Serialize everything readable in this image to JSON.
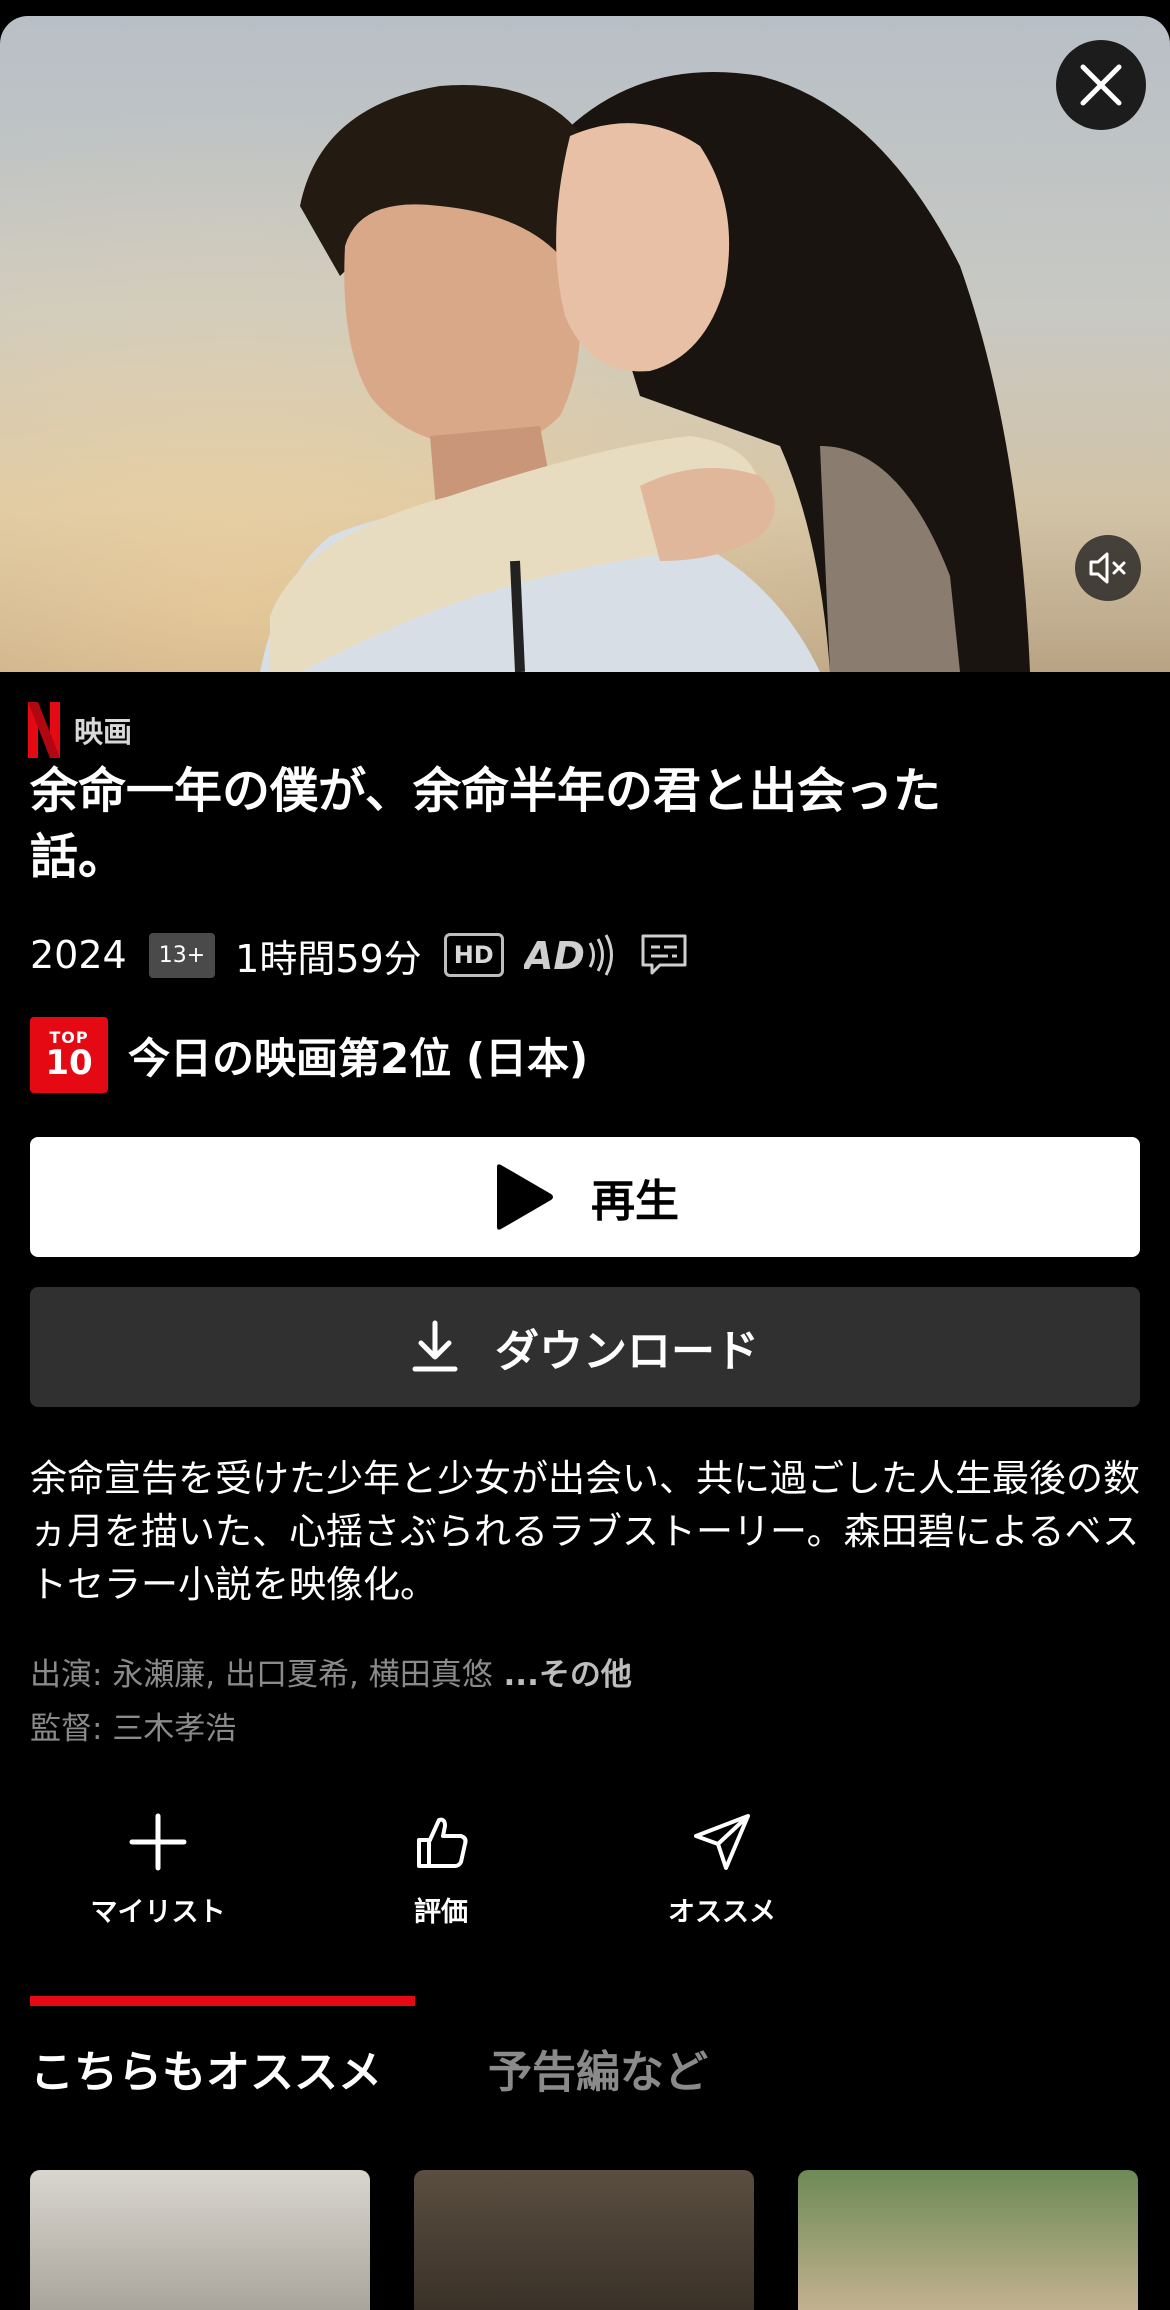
{
  "hero": {
    "image": "movie-key-visual",
    "close_icon": "close-icon",
    "mute_icon": "volume-muted-icon"
  },
  "brand": {
    "logo": "netflix-n-logo",
    "label": "映画",
    "color": "#e50914"
  },
  "title": "余命一年の僕が、余命半年の君と出会った話。",
  "meta": {
    "year": "2024",
    "rating": "13+",
    "duration": "1時間59分",
    "hd": "HD",
    "audio_description_icon": "audio-description-icon",
    "subtitles_icon": "subtitles-icon"
  },
  "top10": {
    "badge_top": "TOP",
    "badge_num": "10",
    "text": "今日の映画第2位 (日本)"
  },
  "buttons": {
    "play": "再生",
    "download": "ダウンロード"
  },
  "description": "余命宣告を受けた少年と少女が出会い、共に過ごした人生最後の数ヵ月を描いた、心揺さぶられるラブストーリー。森田碧によるベストセラー小説を映像化。",
  "credits": {
    "cast_prefix": "出演: ",
    "cast": "永瀬廉, 出口夏希, 横田真悠",
    "more": " ...その他",
    "director_prefix": "監督: ",
    "director": "三木孝浩"
  },
  "actions": [
    {
      "label": "マイリスト",
      "icon": "plus-icon"
    },
    {
      "label": "評価",
      "icon": "thumbs-up-icon"
    },
    {
      "label": "オススメ",
      "icon": "share-icon"
    }
  ],
  "tabs": {
    "active": "こちらもオススメ",
    "inactive": "予告編など"
  },
  "recommendations": [
    {
      "thumbnail": "recommendation-thumbnail"
    },
    {
      "thumbnail": "recommendation-thumbnail"
    },
    {
      "thumbnail": "recommendation-thumbnail"
    }
  ]
}
